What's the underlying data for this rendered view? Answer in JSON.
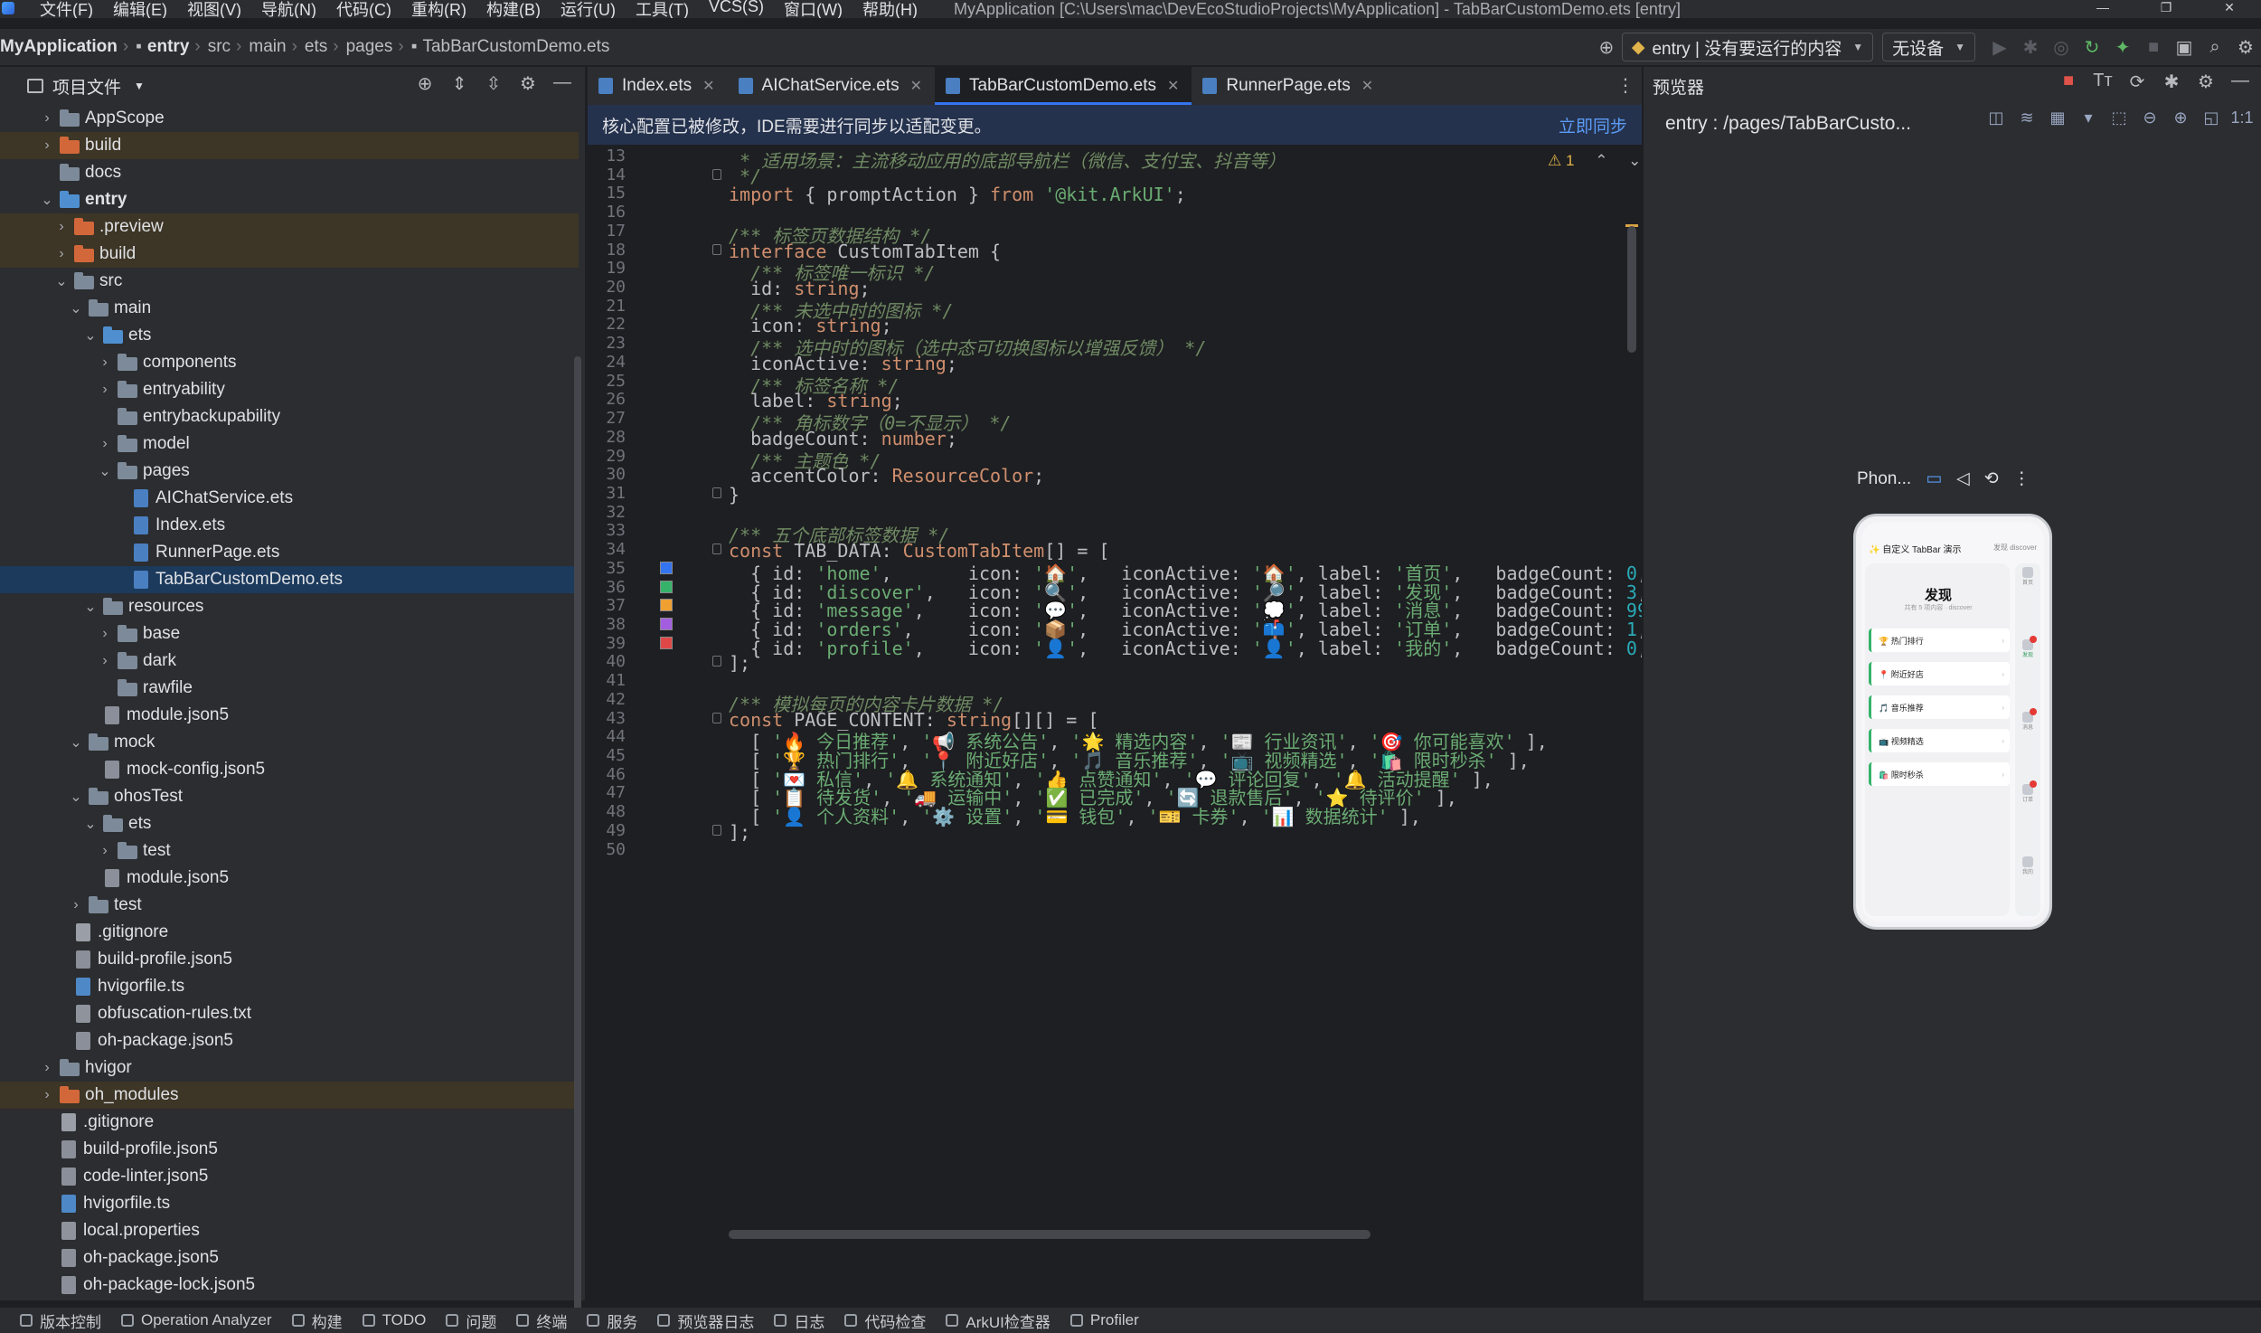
{
  "menubar": {
    "items": [
      "文件(F)",
      "编辑(E)",
      "视图(V)",
      "导航(N)",
      "代码(C)",
      "重构(R)",
      "构建(B)",
      "运行(U)",
      "工具(T)",
      "VCS(S)",
      "窗口(W)",
      "帮助(H)"
    ],
    "window_title": "MyApplication [C:\\Users\\mac\\DevEcoStudioProjects\\MyApplication] - TabBarCustomDemo.ets [entry]"
  },
  "toolbar": {
    "breadcrumb": [
      "MyApplication",
      "entry",
      "src",
      "main",
      "ets",
      "pages",
      "TabBarCustomDemo.ets"
    ],
    "run_config": "entry | 没有要运行的内容",
    "device": "无设备"
  },
  "project": {
    "title": "项目文件",
    "tree": [
      {
        "depth": 1,
        "arrow": "›",
        "icon": "folder",
        "label": "AppScope"
      },
      {
        "depth": 1,
        "arrow": "›",
        "icon": "folder orange",
        "label": "build",
        "hl": true
      },
      {
        "depth": 1,
        "arrow": "",
        "icon": "folder",
        "label": "docs"
      },
      {
        "depth": 1,
        "arrow": "⌄",
        "icon": "folder blue",
        "label": "entry",
        "bold": true
      },
      {
        "depth": 2,
        "arrow": "›",
        "icon": "folder orange",
        "label": ".preview",
        "hl": true
      },
      {
        "depth": 2,
        "arrow": "›",
        "icon": "folder orange",
        "label": "build",
        "hl": true
      },
      {
        "depth": 2,
        "arrow": "⌄",
        "icon": "folder",
        "label": "src"
      },
      {
        "depth": 3,
        "arrow": "⌄",
        "icon": "folder",
        "label": "main"
      },
      {
        "depth": 4,
        "arrow": "⌄",
        "icon": "folder blue",
        "label": "ets"
      },
      {
        "depth": 5,
        "arrow": "›",
        "icon": "folder",
        "label": "components"
      },
      {
        "depth": 5,
        "arrow": "›",
        "icon": "folder",
        "label": "entryability"
      },
      {
        "depth": 5,
        "arrow": "",
        "icon": "folder",
        "label": "entrybackupability"
      },
      {
        "depth": 5,
        "arrow": "›",
        "icon": "folder",
        "label": "model"
      },
      {
        "depth": 5,
        "arrow": "⌄",
        "icon": "folder",
        "label": "pages"
      },
      {
        "depth": 6,
        "arrow": "",
        "icon": "file ets",
        "label": "AIChatService.ets"
      },
      {
        "depth": 6,
        "arrow": "",
        "icon": "file ets",
        "label": "Index.ets"
      },
      {
        "depth": 6,
        "arrow": "",
        "icon": "file ets",
        "label": "RunnerPage.ets"
      },
      {
        "depth": 6,
        "arrow": "",
        "icon": "file ets",
        "label": "TabBarCustomDemo.ets",
        "sel": true
      },
      {
        "depth": 4,
        "arrow": "⌄",
        "icon": "folder",
        "label": "resources"
      },
      {
        "depth": 5,
        "arrow": "›",
        "icon": "folder",
        "label": "base"
      },
      {
        "depth": 5,
        "arrow": "›",
        "icon": "folder",
        "label": "dark"
      },
      {
        "depth": 5,
        "arrow": "",
        "icon": "folder",
        "label": "rawfile"
      },
      {
        "depth": 4,
        "arrow": "",
        "icon": "file json",
        "label": "module.json5"
      },
      {
        "depth": 3,
        "arrow": "⌄",
        "icon": "folder",
        "label": "mock"
      },
      {
        "depth": 4,
        "arrow": "",
        "icon": "file json",
        "label": "mock-config.json5"
      },
      {
        "depth": 3,
        "arrow": "⌄",
        "icon": "folder",
        "label": "ohosTest"
      },
      {
        "depth": 4,
        "arrow": "⌄",
        "icon": "folder",
        "label": "ets"
      },
      {
        "depth": 5,
        "arrow": "›",
        "icon": "folder",
        "label": "test"
      },
      {
        "depth": 4,
        "arrow": "",
        "icon": "file json",
        "label": "module.json5"
      },
      {
        "depth": 3,
        "arrow": "›",
        "icon": "folder",
        "label": "test"
      },
      {
        "depth": 2,
        "arrow": "",
        "icon": "file git",
        "label": ".gitignore"
      },
      {
        "depth": 2,
        "arrow": "",
        "icon": "file json",
        "label": "build-profile.json5"
      },
      {
        "depth": 2,
        "arrow": "",
        "icon": "file ts",
        "label": "hvigorfile.ts"
      },
      {
        "depth": 2,
        "arrow": "",
        "icon": "file txt",
        "label": "obfuscation-rules.txt"
      },
      {
        "depth": 2,
        "arrow": "",
        "icon": "file json",
        "label": "oh-package.json5"
      },
      {
        "depth": 1,
        "arrow": "›",
        "icon": "folder",
        "label": "hvigor"
      },
      {
        "depth": 1,
        "arrow": "›",
        "icon": "folder orange",
        "label": "oh_modules",
        "hl": true
      },
      {
        "depth": 1,
        "arrow": "",
        "icon": "file git",
        "label": ".gitignore"
      },
      {
        "depth": 1,
        "arrow": "",
        "icon": "file json",
        "label": "build-profile.json5"
      },
      {
        "depth": 1,
        "arrow": "",
        "icon": "file json",
        "label": "code-linter.json5"
      },
      {
        "depth": 1,
        "arrow": "",
        "icon": "file ts",
        "label": "hvigorfile.ts"
      },
      {
        "depth": 1,
        "arrow": "",
        "icon": "file txt",
        "label": "local.properties"
      },
      {
        "depth": 1,
        "arrow": "",
        "icon": "file json",
        "label": "oh-package.json5"
      },
      {
        "depth": 1,
        "arrow": "",
        "icon": "file json",
        "label": "oh-package-lock.json5"
      }
    ]
  },
  "tabs": [
    {
      "label": "Index.ets",
      "active": false
    },
    {
      "label": "AIChatService.ets",
      "active": false
    },
    {
      "label": "TabBarCustomDemo.ets",
      "active": true
    },
    {
      "label": "RunnerPage.ets",
      "active": false
    }
  ],
  "notice": {
    "text": "核心配置已被修改，IDE需要进行同步以适配变更。",
    "action": "立即同步"
  },
  "warnings": {
    "count": "1"
  },
  "code": [
    {
      "n": "13",
      "tokens": [
        [
          "cm",
          " * 适用场景：主流移动应用的底部导航栏（微信、支付宝、抖音等）"
        ]
      ]
    },
    {
      "n": "14",
      "tokens": [
        [
          "cm",
          " */"
        ]
      ]
    },
    {
      "n": "15",
      "tokens": [
        [
          "kw",
          "import"
        ],
        [
          "id",
          " { promptAction } "
        ],
        [
          "kw",
          "from"
        ],
        [
          "st",
          " '@kit.ArkUI'"
        ],
        [
          "id",
          ";"
        ]
      ]
    },
    {
      "n": "16",
      "tokens": []
    },
    {
      "n": "17",
      "tokens": [
        [
          "cm",
          "/** 标签页数据结构 */"
        ]
      ]
    },
    {
      "n": "18",
      "tokens": [
        [
          "kw",
          "interface"
        ],
        [
          "id",
          " CustomTabItem {"
        ]
      ]
    },
    {
      "n": "19",
      "tokens": [
        [
          "cm",
          "  /** 标签唯一标识 */"
        ]
      ]
    },
    {
      "n": "20",
      "tokens": [
        [
          "id",
          "  id"
        ],
        [
          "id",
          ": "
        ],
        [
          "kw",
          "string"
        ],
        [
          "id",
          ";"
        ]
      ]
    },
    {
      "n": "21",
      "tokens": [
        [
          "cm",
          "  /** 未选中时的图标 */"
        ]
      ]
    },
    {
      "n": "22",
      "tokens": [
        [
          "id",
          "  icon: "
        ],
        [
          "kw",
          "string"
        ],
        [
          "id",
          ";"
        ]
      ]
    },
    {
      "n": "23",
      "tokens": [
        [
          "cm",
          "  /** 选中时的图标（选中态可切换图标以增强反馈） */"
        ]
      ]
    },
    {
      "n": "24",
      "tokens": [
        [
          "id",
          "  iconActive: "
        ],
        [
          "kw",
          "string"
        ],
        [
          "id",
          ";"
        ]
      ]
    },
    {
      "n": "25",
      "tokens": [
        [
          "cm",
          "  /** 标签名称 */"
        ]
      ]
    },
    {
      "n": "26",
      "tokens": [
        [
          "id",
          "  label: "
        ],
        [
          "kw",
          "string"
        ],
        [
          "id",
          ";"
        ]
      ]
    },
    {
      "n": "27",
      "tokens": [
        [
          "cm",
          "  /** 角标数字（0=不显示） */"
        ]
      ]
    },
    {
      "n": "28",
      "tokens": [
        [
          "id",
          "  badgeCount: "
        ],
        [
          "kw",
          "number"
        ],
        [
          "id",
          ";"
        ]
      ]
    },
    {
      "n": "29",
      "tokens": [
        [
          "cm",
          "  /** 主题色 */"
        ]
      ]
    },
    {
      "n": "30",
      "tokens": [
        [
          "id",
          "  accentColor: "
        ],
        [
          "kw",
          "ResourceColor"
        ],
        [
          "id",
          ";"
        ]
      ]
    },
    {
      "n": "31",
      "tokens": [
        [
          "id",
          "}"
        ]
      ]
    },
    {
      "n": "32",
      "tokens": []
    },
    {
      "n": "33",
      "tokens": [
        [
          "cm",
          "/** 五个底部标签数据 */"
        ]
      ]
    },
    {
      "n": "34",
      "tokens": [
        [
          "kw",
          "const"
        ],
        [
          "id",
          " TAB_DATA: "
        ],
        [
          "kw",
          "CustomTabItem"
        ],
        [
          "id",
          "[] = ["
        ]
      ]
    },
    {
      "n": "35",
      "sw": "#3574f0",
      "tokens": [
        [
          "id",
          "  { id: "
        ],
        [
          "st",
          "'home'"
        ],
        [
          "id",
          ",       icon: "
        ],
        [
          "st",
          "'🏠'"
        ],
        [
          "id",
          ",   iconActive: "
        ],
        [
          "st",
          "'🏠'"
        ],
        [
          "id",
          ", label: "
        ],
        [
          "st",
          "'首页'"
        ],
        [
          "id",
          ",   badgeCount: "
        ],
        [
          "nu",
          "0"
        ],
        [
          "id",
          ","
        ]
      ]
    },
    {
      "n": "36",
      "sw": "#36b36a",
      "tokens": [
        [
          "id",
          "  { id: "
        ],
        [
          "st",
          "'discover'"
        ],
        [
          "id",
          ",   icon: "
        ],
        [
          "st",
          "'🔍'"
        ],
        [
          "id",
          ",   iconActive: "
        ],
        [
          "st",
          "'🔎'"
        ],
        [
          "id",
          ", label: "
        ],
        [
          "st",
          "'发现'"
        ],
        [
          "id",
          ",   badgeCount: "
        ],
        [
          "nu",
          "3"
        ],
        [
          "id",
          ","
        ]
      ]
    },
    {
      "n": "37",
      "sw": "#f0a030",
      "tokens": [
        [
          "id",
          "  { id: "
        ],
        [
          "st",
          "'message'"
        ],
        [
          "id",
          ",    icon: "
        ],
        [
          "st",
          "'💬'"
        ],
        [
          "id",
          ",   iconActive: "
        ],
        [
          "st",
          "'💭'"
        ],
        [
          "id",
          ", label: "
        ],
        [
          "st",
          "'消息'"
        ],
        [
          "id",
          ",   badgeCount: "
        ],
        [
          "nu",
          "99"
        ]
      ]
    },
    {
      "n": "38",
      "sw": "#a35ee0",
      "tokens": [
        [
          "id",
          "  { id: "
        ],
        [
          "st",
          "'orders'"
        ],
        [
          "id",
          ",     icon: "
        ],
        [
          "st",
          "'📦'"
        ],
        [
          "id",
          ",   iconActive: "
        ],
        [
          "st",
          "'📫'"
        ],
        [
          "id",
          ", label: "
        ],
        [
          "st",
          "'订单'"
        ],
        [
          "id",
          ",   badgeCount: "
        ],
        [
          "nu",
          "1"
        ],
        [
          "id",
          ","
        ]
      ]
    },
    {
      "n": "39",
      "sw": "#e04848",
      "tokens": [
        [
          "id",
          "  { id: "
        ],
        [
          "st",
          "'profile'"
        ],
        [
          "id",
          ",    icon: "
        ],
        [
          "st",
          "'👤'"
        ],
        [
          "id",
          ",   iconActive: "
        ],
        [
          "st",
          "'👤'"
        ],
        [
          "id",
          ", label: "
        ],
        [
          "st",
          "'我的'"
        ],
        [
          "id",
          ",   badgeCount: "
        ],
        [
          "nu",
          "0"
        ],
        [
          "id",
          ","
        ]
      ]
    },
    {
      "n": "40",
      "tokens": [
        [
          "id",
          "];"
        ]
      ]
    },
    {
      "n": "41",
      "tokens": []
    },
    {
      "n": "42",
      "tokens": [
        [
          "cm",
          "/** 模拟每页的内容卡片数据 */"
        ]
      ]
    },
    {
      "n": "43",
      "tokens": [
        [
          "kw",
          "const"
        ],
        [
          "id",
          " PAGE_CONTENT: "
        ],
        [
          "kw",
          "string"
        ],
        [
          "id",
          "[][] = ["
        ]
      ]
    },
    {
      "n": "44",
      "tokens": [
        [
          "id",
          "  [ "
        ],
        [
          "st",
          "'🔥 今日推荐'"
        ],
        [
          "id",
          ", "
        ],
        [
          "st",
          "'📢 系统公告'"
        ],
        [
          "id",
          ", "
        ],
        [
          "st",
          "'🌟 精选内容'"
        ],
        [
          "id",
          ", "
        ],
        [
          "st",
          "'📰 行业资讯'"
        ],
        [
          "id",
          ", "
        ],
        [
          "st",
          "'🎯 你可能喜欢'"
        ],
        [
          "id",
          " ],"
        ]
      ]
    },
    {
      "n": "45",
      "tokens": [
        [
          "id",
          "  [ "
        ],
        [
          "st",
          "'🏆 热门排行'"
        ],
        [
          "id",
          ", "
        ],
        [
          "st",
          "'📍 附近好店'"
        ],
        [
          "id",
          ", "
        ],
        [
          "st",
          "'🎵 音乐推荐'"
        ],
        [
          "id",
          ", "
        ],
        [
          "st",
          "'📺 视频精选'"
        ],
        [
          "id",
          ", "
        ],
        [
          "st",
          "'🛍️ 限时秒杀'"
        ],
        [
          "id",
          " ],"
        ]
      ]
    },
    {
      "n": "46",
      "tokens": [
        [
          "id",
          "  [ "
        ],
        [
          "st",
          "'💌 私信'"
        ],
        [
          "id",
          ", "
        ],
        [
          "st",
          "'🔔 系统通知'"
        ],
        [
          "id",
          ", "
        ],
        [
          "st",
          "'👍 点赞通知'"
        ],
        [
          "id",
          ", "
        ],
        [
          "st",
          "'💬 评论回复'"
        ],
        [
          "id",
          ", "
        ],
        [
          "st",
          "'🔔 活动提醒'"
        ],
        [
          "id",
          " ],"
        ]
      ]
    },
    {
      "n": "47",
      "tokens": [
        [
          "id",
          "  [ "
        ],
        [
          "st",
          "'📋 待发货'"
        ],
        [
          "id",
          ", "
        ],
        [
          "st",
          "'🚚 运输中'"
        ],
        [
          "id",
          ", "
        ],
        [
          "st",
          "'✅ 已完成'"
        ],
        [
          "id",
          ", "
        ],
        [
          "st",
          "'🔄 退款售后'"
        ],
        [
          "id",
          ", "
        ],
        [
          "st",
          "'⭐ 待评价'"
        ],
        [
          "id",
          " ],"
        ]
      ]
    },
    {
      "n": "48",
      "tokens": [
        [
          "id",
          "  [ "
        ],
        [
          "st",
          "'👤 个人资料'"
        ],
        [
          "id",
          ", "
        ],
        [
          "st",
          "'⚙️ 设置'"
        ],
        [
          "id",
          ", "
        ],
        [
          "st",
          "'💳 钱包'"
        ],
        [
          "id",
          ", "
        ],
        [
          "st",
          "'🎫 卡券'"
        ],
        [
          "id",
          ", "
        ],
        [
          "st",
          "'📊 数据统计'"
        ],
        [
          "id",
          " ],"
        ]
      ]
    },
    {
      "n": "49",
      "tokens": [
        [
          "id",
          "];"
        ]
      ]
    },
    {
      "n": "50",
      "tokens": []
    }
  ],
  "preview": {
    "title": "预览器",
    "path": "entry : /pages/TabBarCusto...",
    "device": "Phon...",
    "phone": {
      "app_title": "✨ 自定义 TabBar 演示",
      "header_right": "发现  discover",
      "page_title": "发现",
      "page_sub": "共有 5 项内容 · discover",
      "items": [
        "🏆 热门排行",
        "📍 附近好店",
        "🎵 音乐推荐",
        "📺 视频精选",
        "🛍️ 限时秒杀"
      ],
      "tabs": [
        "首页",
        "发现",
        "消息",
        "订单",
        "我的"
      ]
    }
  },
  "statusbar": {
    "items": [
      "版本控制",
      "Operation Analyzer",
      "构建",
      "TODO",
      "问题",
      "终端",
      "服务",
      "预览器日志",
      "日志",
      "代码检查",
      "ArkUI检查器",
      "Profiler"
    ]
  }
}
